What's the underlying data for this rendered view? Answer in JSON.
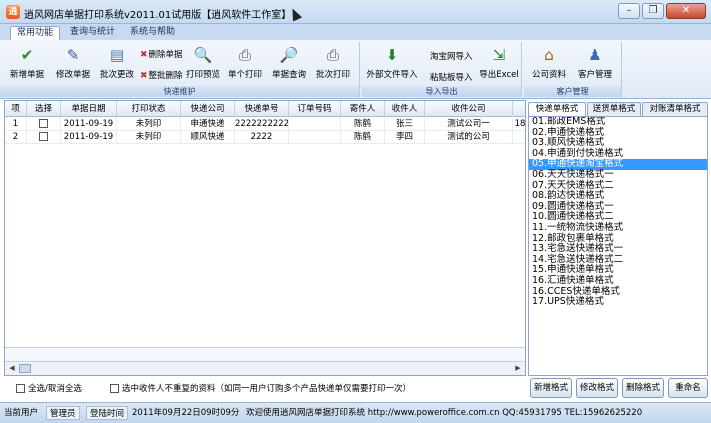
{
  "window": {
    "title": "逍风网店单据打印系统v2011.01试用版【逍风软件工作室】",
    "app_icon": "逍",
    "buttons": [
      "minimize-icon",
      "restore-icon",
      "close-icon"
    ]
  },
  "tabs": [
    {
      "label": "常用功能",
      "active": true
    },
    {
      "label": "查询与统计",
      "active": false
    },
    {
      "label": "系统与帮助",
      "active": false
    }
  ],
  "ribbon": {
    "group1": {
      "label": "快递维护",
      "buttons": [
        {
          "label": "新增单据",
          "icon": "✔"
        },
        {
          "label": "修改单据",
          "icon": "✎"
        },
        {
          "label": "批次更改",
          "icon": "▤"
        },
        {
          "label": "删除单据",
          "icon": "✖"
        },
        {
          "label": "整批删除",
          "icon": "✖"
        },
        {
          "label": "打印预览",
          "icon": "🔍"
        },
        {
          "label": "单个打印",
          "icon": "⎙"
        },
        {
          "label": "单据查询",
          "icon": "🔎"
        },
        {
          "label": "批次打印",
          "icon": "⎙"
        }
      ]
    },
    "group2": {
      "label": "导入导出",
      "buttons": [
        {
          "label": "外部文件导入",
          "icon": "⬇"
        },
        {
          "label": "淘宝网导入",
          "icon": ""
        },
        {
          "label": "粘贴板导入",
          "icon": ""
        },
        {
          "label": "导出Excel",
          "icon": "⇲"
        }
      ]
    },
    "group3": {
      "label": "客户管理",
      "buttons": [
        {
          "label": "公司资料",
          "icon": "⌂"
        },
        {
          "label": "客户管理",
          "icon": "♟"
        }
      ]
    }
  },
  "grid": {
    "columns": [
      "项",
      "选择",
      "单据日期",
      "打印状态",
      "快递公司",
      "快递单号",
      "订单号码",
      "寄件人",
      "收件人",
      "收件公司",
      ""
    ],
    "rows": [
      {
        "no": "1",
        "date": "2011-09-19",
        "status": "未列印",
        "company": "申通快递",
        "number": "22222222222",
        "order": "",
        "sender": "陈鹤",
        "receiver": "张三",
        "rcompany": "测试公司一",
        "extra": "18"
      },
      {
        "no": "2",
        "date": "2011-09-19",
        "status": "未列印",
        "company": "顺风快递",
        "number": "2222",
        "order": "",
        "sender": "陈鹤",
        "receiver": "李四",
        "rcompany": "测试的公司",
        "extra": ""
      }
    ]
  },
  "options": {
    "select_all": "全选/取消全选",
    "unique_receivers": "选中收件人不重复的资料（如同一用户订购多个产品快递单仅需要打印一次）"
  },
  "right_tabs": [
    {
      "label": "快递单格式",
      "active": true
    },
    {
      "label": "送货单格式",
      "active": false
    },
    {
      "label": "对账清单格式",
      "active": false
    }
  ],
  "formats": [
    "01.邮政EMS格式",
    "02.申通快递格式",
    "03.顺风快递格式",
    "04.申通到付快递格式",
    "05.申通快递淘宝格式",
    "06.天天快递格式一",
    "07.天天快递格式二",
    "08.韵达快递格式",
    "09.圆通快递格式一",
    "10.圆通快递格式二",
    "11.一统物流快递格式",
    "12.邮政包裹单格式",
    "13.宅急送快递格式一",
    "14.宅急送快递格式二",
    "15.申通快递单格式",
    "16.汇通快递单格式",
    "16.CCES快递单格式",
    "17.UPS快递格式"
  ],
  "selected_format_index": 4,
  "format_buttons": [
    "新增格式",
    "修改格式",
    "删除格式",
    "重命名"
  ],
  "status": {
    "user_label": "当前用户",
    "user_value": "管理员",
    "login_label": "登陆时间",
    "login_value": "2011年09月22日09时09分",
    "message": "欢迎使用逍风网店单据打印系统 http://www.poweroffice.com.cn QQ:45931795 TEL:15962625220"
  }
}
